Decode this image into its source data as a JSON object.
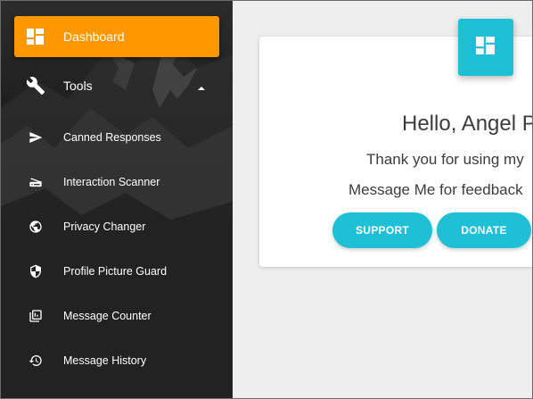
{
  "sidebar": {
    "items": [
      {
        "label": "Dashboard",
        "icon": "dashboard-icon",
        "active": true
      },
      {
        "label": "Tools",
        "icon": "wrench-icon",
        "expanded": true
      },
      {
        "label": "Canned Responses",
        "icon": "send-icon"
      },
      {
        "label": "Interaction Scanner",
        "icon": "scanner-icon"
      },
      {
        "label": "Privacy Changer",
        "icon": "globe-icon"
      },
      {
        "label": "Profile Picture Guard",
        "icon": "shield-icon"
      },
      {
        "label": "Message Counter",
        "icon": "counter-icon"
      },
      {
        "label": "Message History",
        "icon": "history-icon"
      }
    ]
  },
  "main": {
    "greeting": "Hello, Angel P",
    "thanks_line": "Thank you for using my",
    "feedback_line": "Message Me for feedback",
    "buttons": {
      "support": "SUPPORT",
      "donate": "DONATE"
    }
  },
  "colors": {
    "accent": "#ff9800",
    "cyan": "#1ec0d6",
    "sidebar": "#1a1a1a",
    "background": "#eeeeee"
  }
}
